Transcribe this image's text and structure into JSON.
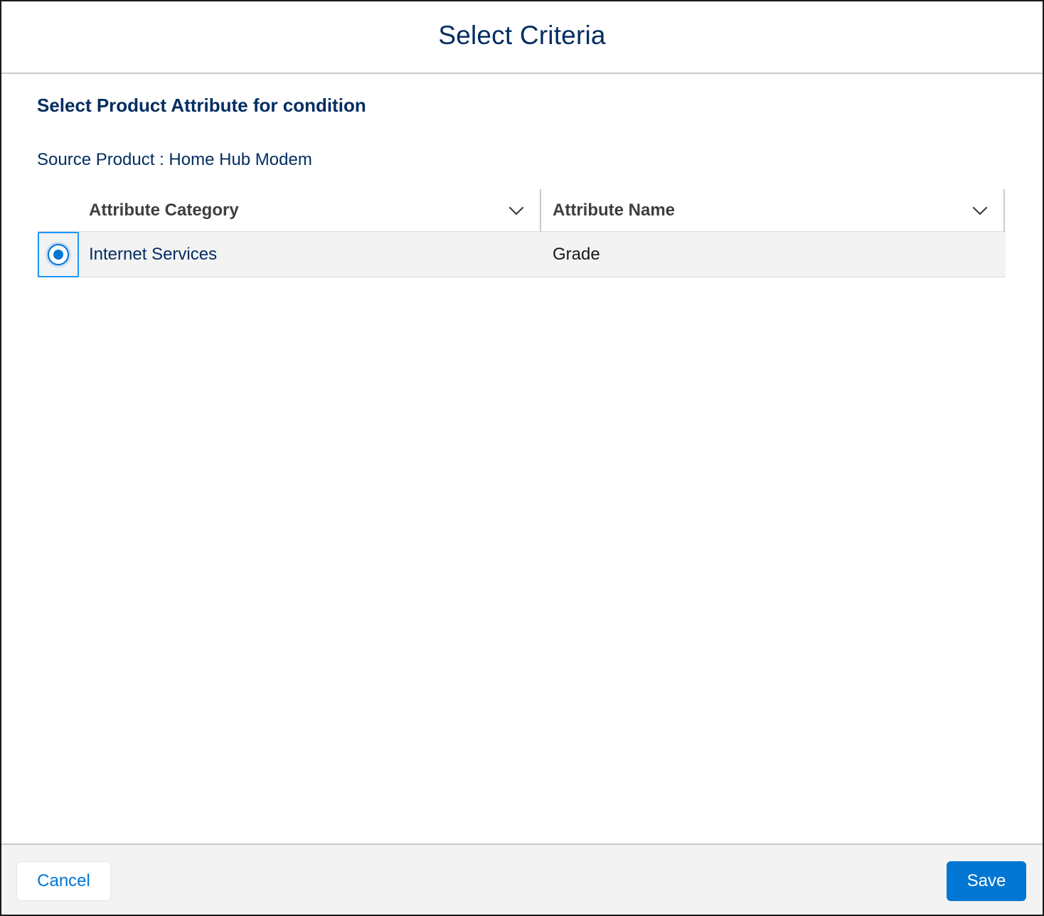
{
  "modal": {
    "title": "Select Criteria"
  },
  "body": {
    "section_heading": "Select Product Attribute for condition",
    "source_product": "Source Product : Home Hub Modem"
  },
  "table": {
    "columns": [
      {
        "label": "Attribute Category",
        "icon": "chevron-down-icon"
      },
      {
        "label": "Attribute Name",
        "icon": "chevron-down-icon"
      }
    ],
    "rows": [
      {
        "selected": true,
        "category": "Internet Services",
        "name": "Grade"
      }
    ]
  },
  "footer": {
    "cancel_label": "Cancel",
    "save_label": "Save"
  },
  "colors": {
    "title_text": "#032d60",
    "brand_blue": "#0176d3",
    "row_background": "#f3f3f3",
    "footer_background": "#f3f3f3"
  }
}
